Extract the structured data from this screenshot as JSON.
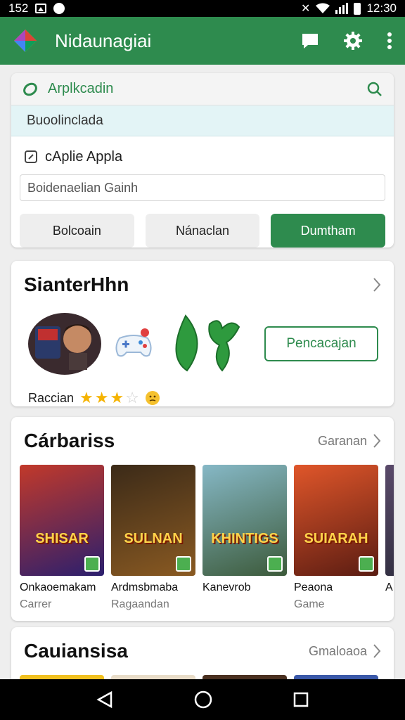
{
  "status": {
    "time_left": "152",
    "time_right": "12:30"
  },
  "app_bar": {
    "title": "Nidaunagiai"
  },
  "search": {
    "label": "Arplkcadin",
    "download_strip": "Buoolinclada",
    "app_label": "cAplie Appla",
    "input_value": "Boidenaelian Gainh",
    "buttons": [
      "Bolcoain",
      "Nánaclan",
      "Dumtham"
    ]
  },
  "recommend": {
    "title": "SianterHhn",
    "action_button": "Pencacajan",
    "rating_label": "Raccian",
    "rating": 3,
    "rating_max": 4
  },
  "categories": {
    "title": "Cárbariss",
    "more": "Garanan",
    "games": [
      {
        "art_title": "SHISAR",
        "name": "Onkaoemakam",
        "sub": "Carrer",
        "colors": [
          "#c2392a",
          "#2b1f6e"
        ]
      },
      {
        "art_title": "SULNAN",
        "name": "Ardmsbmaba",
        "sub": "Ragaandan",
        "colors": [
          "#3b2a18",
          "#8a5a22"
        ]
      },
      {
        "art_title": "KHINTIGS",
        "name": "Kanevrob",
        "sub": "",
        "colors": [
          "#86b8c6",
          "#3c5a3a"
        ]
      },
      {
        "art_title": "SUIARAH",
        "name": "Peaona",
        "sub": "Game",
        "colors": [
          "#e0562a",
          "#5a1c12"
        ]
      },
      {
        "art_title": "",
        "name": "A",
        "sub": "",
        "colors": [
          "#5a4a6a",
          "#2a2a3a"
        ]
      }
    ]
  },
  "categories2": {
    "title": "Cauiansisa",
    "more": "Gmaloaoa"
  },
  "colors": {
    "brand": "#2e8b4e",
    "star": "#f5b301"
  }
}
